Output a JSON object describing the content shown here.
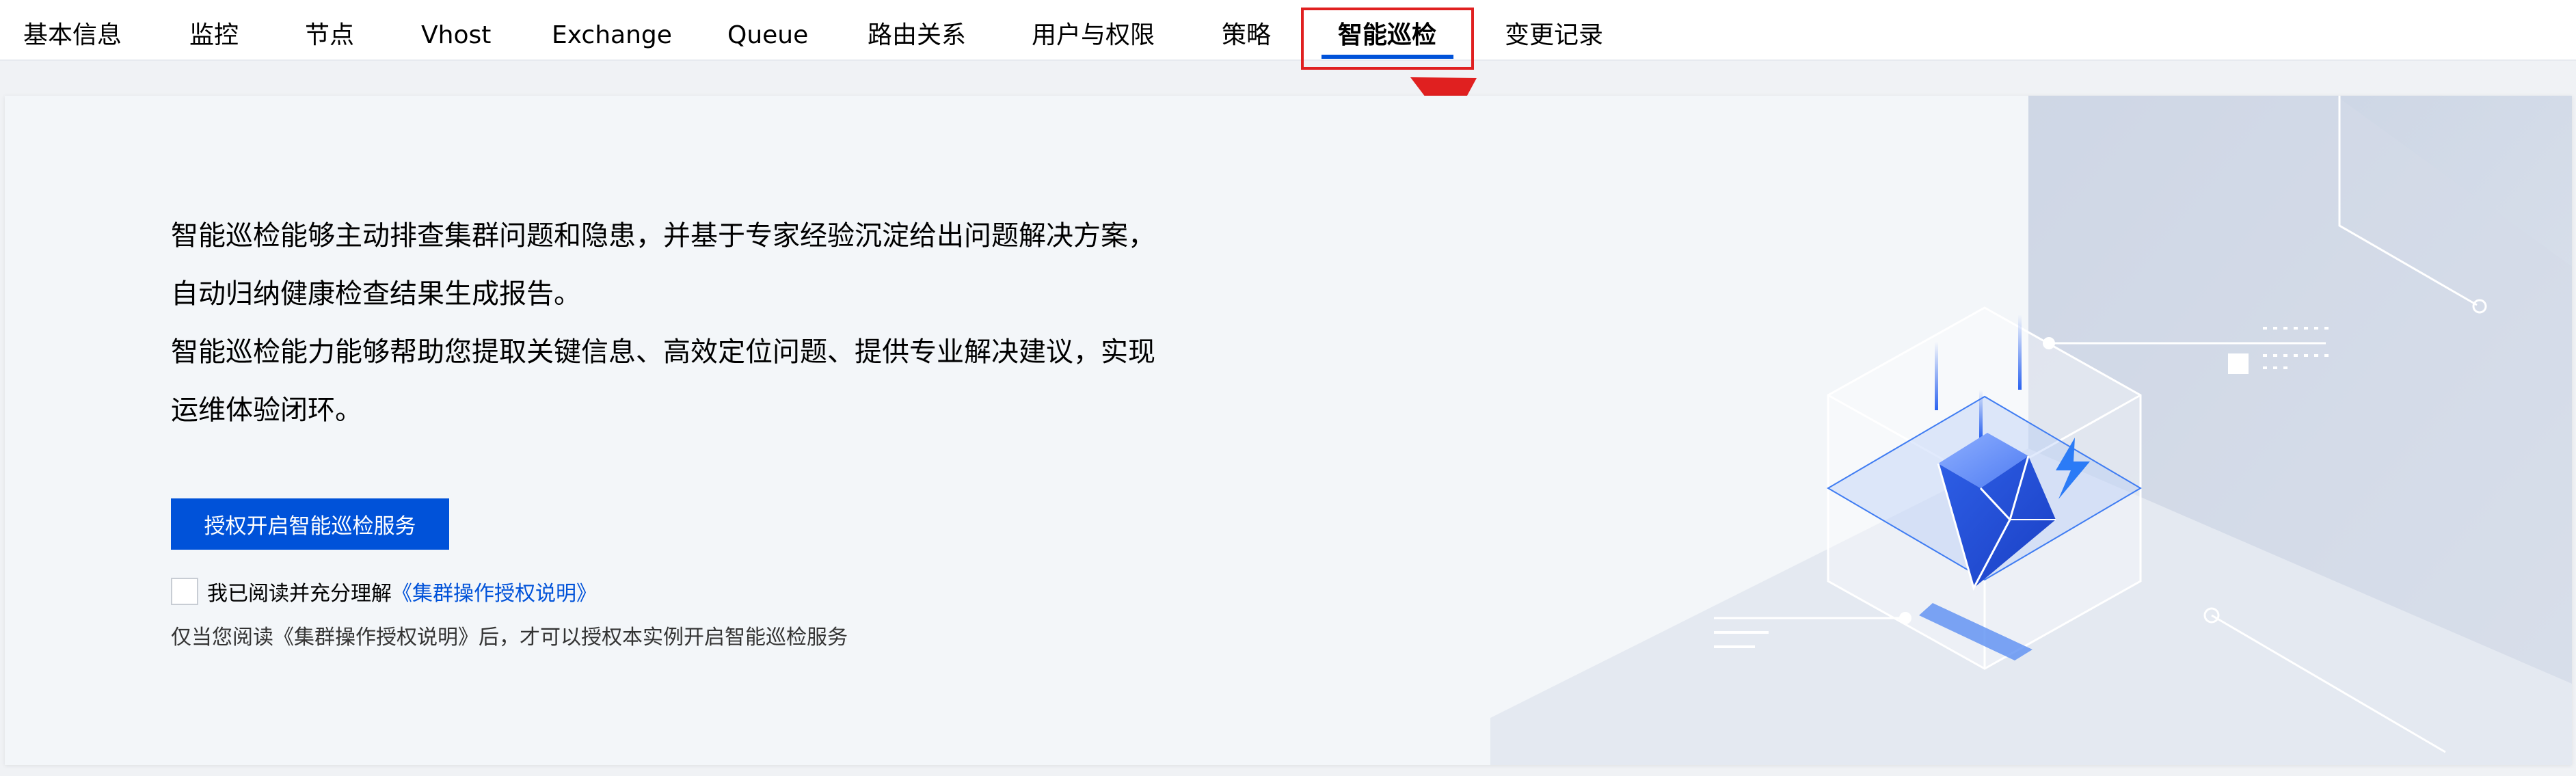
{
  "tabs": [
    {
      "key": "basic",
      "label": "基本信息",
      "active": false
    },
    {
      "key": "monitor",
      "label": "监控",
      "active": false
    },
    {
      "key": "node",
      "label": "节点",
      "active": false
    },
    {
      "key": "vhost",
      "label": "Vhost",
      "active": false
    },
    {
      "key": "exchange",
      "label": "Exchange",
      "active": false
    },
    {
      "key": "queue",
      "label": "Queue",
      "active": false
    },
    {
      "key": "routing",
      "label": "路由关系",
      "active": false
    },
    {
      "key": "users",
      "label": "用户与权限",
      "active": false
    },
    {
      "key": "policy",
      "label": "策略",
      "active": false
    },
    {
      "key": "inspection",
      "label": "智能巡检",
      "active": true
    },
    {
      "key": "changelog",
      "label": "变更记录",
      "active": false
    }
  ],
  "intro": {
    "lines": [
      "智能巡检能够主动排查集群问题和隐患，并基于专家经验沉淀给出问题解决方案，",
      "自动归纳健康检查结果生成报告。",
      "智能巡检能力能够帮助您提取关键信息、高效定位问题、提供专业解决建议，实现",
      "运维体验闭环。"
    ]
  },
  "enable_button": "授权开启智能巡检服务",
  "agreement": {
    "checked": false,
    "prefix": "我已阅读并充分理解",
    "link": "《集群操作授权说明》"
  },
  "hint": "仅当您阅读《集群操作授权说明》后，才可以授权本实例开启智能巡检服务",
  "colors": {
    "primary": "#0052d9",
    "annotation_red": "#e02020",
    "card_bg": "#f3f6f9"
  }
}
